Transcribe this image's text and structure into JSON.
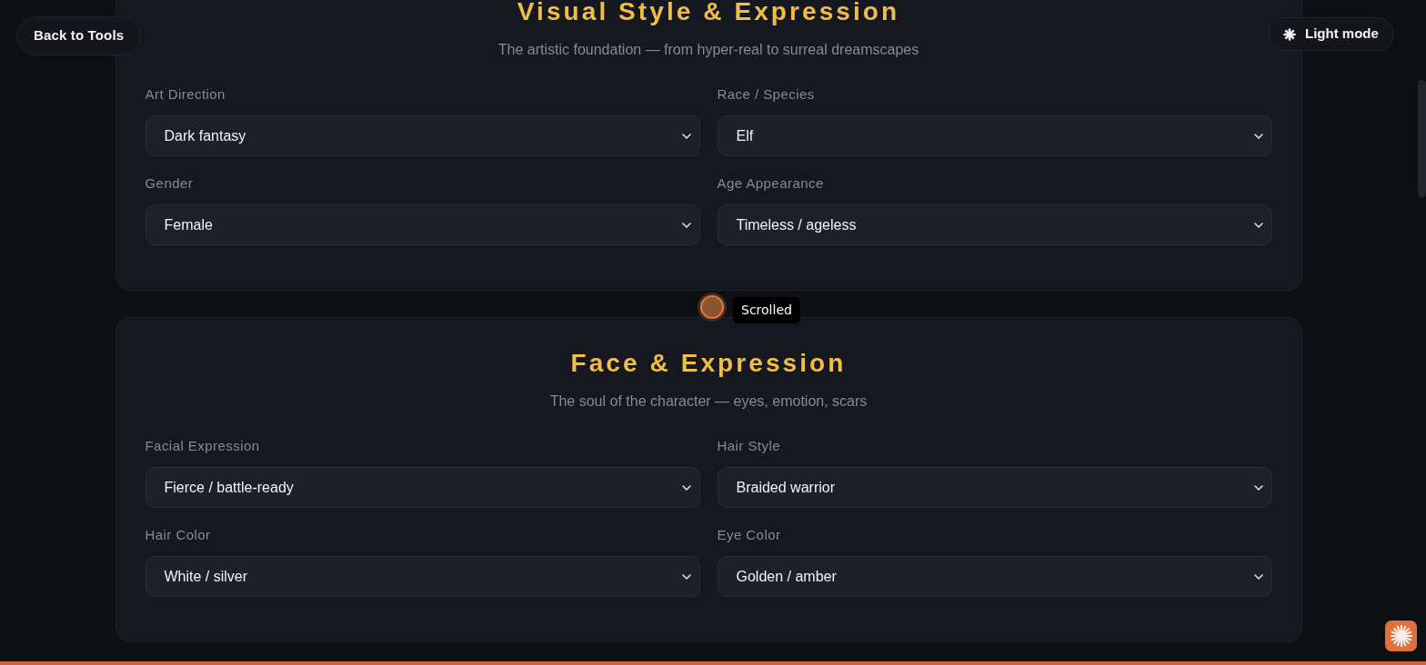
{
  "header": {
    "back_button": "Back to Tools",
    "theme_toggle": "Light mode"
  },
  "sections": [
    {
      "title": "Visual Style & Expression",
      "subtitle": "The artistic foundation — from hyper-real to surreal dreamscapes",
      "fields": [
        {
          "label": "Art Direction",
          "value": "Dark fantasy"
        },
        {
          "label": "Race / Species",
          "value": "Elf"
        },
        {
          "label": "Gender",
          "value": "Female"
        },
        {
          "label": "Age Appearance",
          "value": "Timeless / ageless"
        }
      ]
    },
    {
      "title": "Face & Expression",
      "subtitle": "The soul of the character — eyes, emotion, scars",
      "fields": [
        {
          "label": "Facial Expression",
          "value": "Fierce / battle-ready"
        },
        {
          "label": "Hair Style",
          "value": "Braided warrior"
        },
        {
          "label": "Hair Color",
          "value": "White / silver"
        },
        {
          "label": "Eye Color",
          "value": "Golden / amber"
        }
      ]
    }
  ],
  "scroll_tooltip": "Scrolled"
}
